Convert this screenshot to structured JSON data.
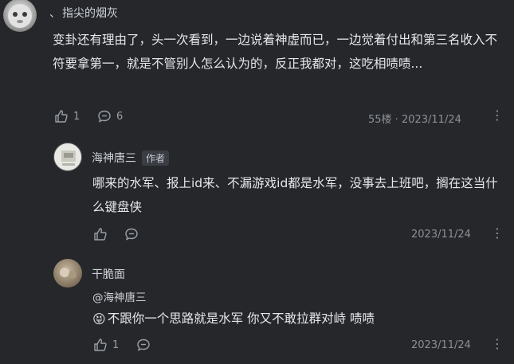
{
  "comment1": {
    "prefix": "、",
    "username": "指尖的烟灰",
    "text": "变卦还有理由了，头一次看到，一边说着神虚而已，一边觉着付出和第三名收入不符要拿第一，就是不管别人怎么认为的，反正我都对，这吃相啧啧...",
    "likes": "1",
    "replies": "6",
    "floor_date": "55楼 · 2023/11/24"
  },
  "reply1": {
    "username": "海神唐三",
    "author_badge": "作者",
    "text": "哪来的水军、报上id来、不漏游戏id都是水军，没事去上班吧，搁在这当什么键盘侠",
    "date": "2023/11/24"
  },
  "reply2": {
    "username": "干脆面",
    "mention": "@海神唐三",
    "emoji": "😝",
    "text": "不跟你一个思路就是水军 你又不敢拉群对峙 啧啧",
    "likes": "1",
    "date": "2023/11/24"
  },
  "icons": {
    "like": "thumbs-up-icon",
    "reply": "comment-bubble-icon",
    "more": "more-vertical-icon"
  }
}
